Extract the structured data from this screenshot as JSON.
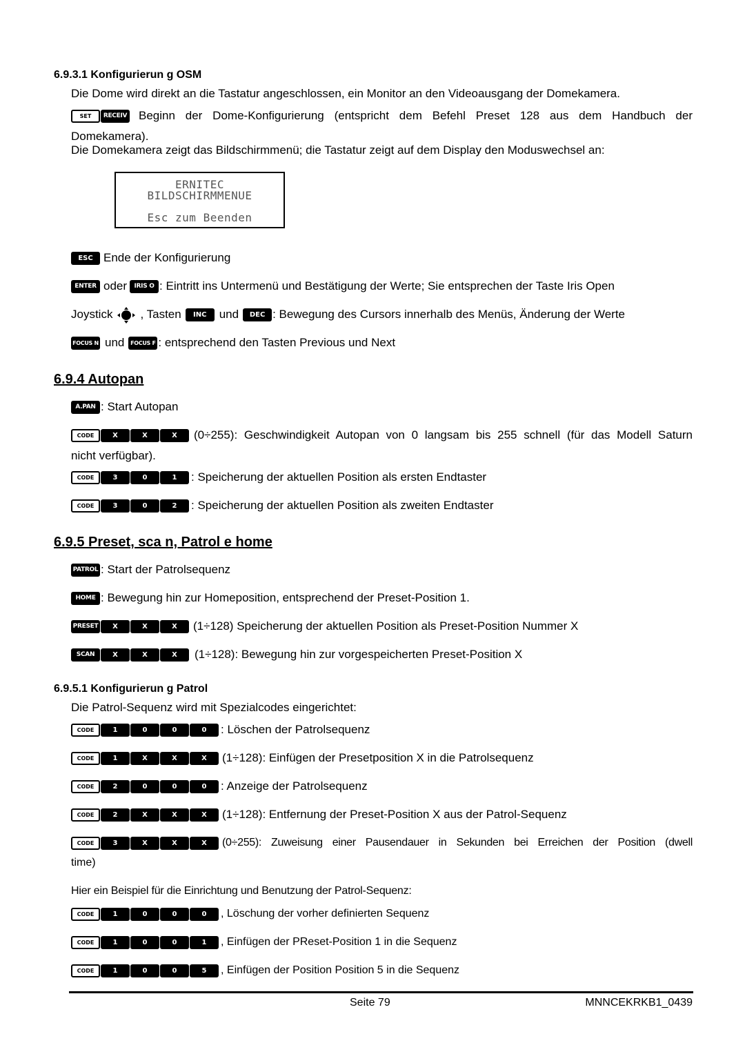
{
  "s6931": {
    "heading": "6.9.3.1 Konfigurierun g OSM",
    "line1": "Die Dome wird direkt an die Tastatur angeschlossen, ein Monitor an den Videoausgang der Domekamera.",
    "set_key": "SET",
    "receiv_key": "RECEIV",
    "line2a": "Beginn der Dome-Konfigurierung (entspricht dem Befehl Preset 128 aus dem Handbuch der",
    "line2b": "Domekamera).",
    "line3": "Die Domekamera zeigt das Bildschirmmenü; die Tastatur zeigt auf dem Display den Moduswechsel an:",
    "lcd": {
      "line1": "ERNITEC",
      "line2": "BILDSCHIRMMENUE",
      "line3": "Esc zum Beenden"
    },
    "esc_key": "ESC",
    "esc_text": "Ende der Konfigurierung",
    "enter_key": "ENTER",
    "oder": "oder",
    "iris_key": "IRIS O",
    "enter_text": ": Eintritt ins Untermenü und Bestätigung der Werte; Sie entsprechen der Taste Iris Open",
    "joystick_label": "Joystick",
    "tasten": ", Tasten",
    "inc_key": "INC",
    "und": "und",
    "dec_key": "DEC",
    "joy_text": ": Bewegung des Cursors innerhalb des Menüs, Änderung der Werte",
    "focusn_key": "FOCUS N",
    "focusf_key": "FOCUS F",
    "focus_text": ": entsprechend den Tasten Previous und Next"
  },
  "s694": {
    "heading": "6.9.4 Autopan",
    "apan_key": "A.PAN",
    "apan_text": ": Start Autopan",
    "rows": [
      {
        "keys": [
          "X",
          "X",
          "X"
        ],
        "text": "(0÷255): Geschwindigkeit Autopan von 0 langsam bis 255 schnell (für das Modell Saturn",
        "cont": "nicht verfügbar)."
      },
      {
        "keys": [
          "3",
          "0",
          "1"
        ],
        "text": ": Speicherung der aktuellen Position als ersten Endtaster"
      },
      {
        "keys": [
          "3",
          "0",
          "2"
        ],
        "text": ": Speicherung der aktuellen Position als zweiten Endtaster"
      }
    ]
  },
  "s695": {
    "heading": "6.9.5 Preset, sca n, Patrol e home",
    "patrol_key": "PATROL",
    "patrol_text": ": Start der Patrolsequenz",
    "home_key": "HOME",
    "home_text": ": Bewegung hin zur Homeposition, entsprechend der Preset-Position 1.",
    "preset_key": "PRESET",
    "preset_text": "(1÷128) Speicherung der aktuellen Position als Preset-Position Nummer X",
    "scan_key": "SCAN",
    "scan_text": "(1÷128): Bewegung hin zur vorgespeicherten Preset-Position X",
    "x": "X"
  },
  "s6951": {
    "heading": "6.9.5.1 Konfigurierun g Patrol",
    "intro": "Die Patrol-Sequenz wird mit Spezialcodes eingerichtet:",
    "rows": [
      {
        "keys": [
          "1",
          "0",
          "0",
          "0"
        ],
        "text": ": Löschen der Patrolsequenz"
      },
      {
        "keys": [
          "1",
          "X",
          "X",
          "X"
        ],
        "text": "(1÷128): Einfügen der Presetposition X in die Patrolsequenz"
      },
      {
        "keys": [
          "2",
          "0",
          "0",
          "0"
        ],
        "text": ": Anzeige der Patrolsequenz"
      },
      {
        "keys": [
          "2",
          "X",
          "X",
          "X"
        ],
        "text": "(1÷128): Entfernung der Preset-Position X aus der Patrol-Sequenz"
      },
      {
        "keys": [
          "3",
          "X",
          "X",
          "X"
        ],
        "text": "(0÷255): Zuweisung einer Pausendauer in Sekunden bei Erreichen der Position (dwell",
        "cont": "time)"
      }
    ],
    "example_intro": "Hier ein Beispiel für die Einrichtung und Benutzung der Patrol-Sequenz:",
    "examples": [
      {
        "keys": [
          "1",
          "0",
          "0",
          "0"
        ],
        "text": ", Löschung der vorher definierten Sequenz"
      },
      {
        "keys": [
          "1",
          "0",
          "0",
          "1"
        ],
        "text": ", Einfügen der PReset-Position 1 in die Sequenz"
      },
      {
        "keys": [
          "1",
          "0",
          "0",
          "5"
        ],
        "text": ", Einfügen der Position Position 5 in die Sequenz"
      }
    ]
  },
  "code_key": "CODE",
  "footer": {
    "page": "Seite 79",
    "doc_id": "MNNCEKRKB1_0439"
  }
}
